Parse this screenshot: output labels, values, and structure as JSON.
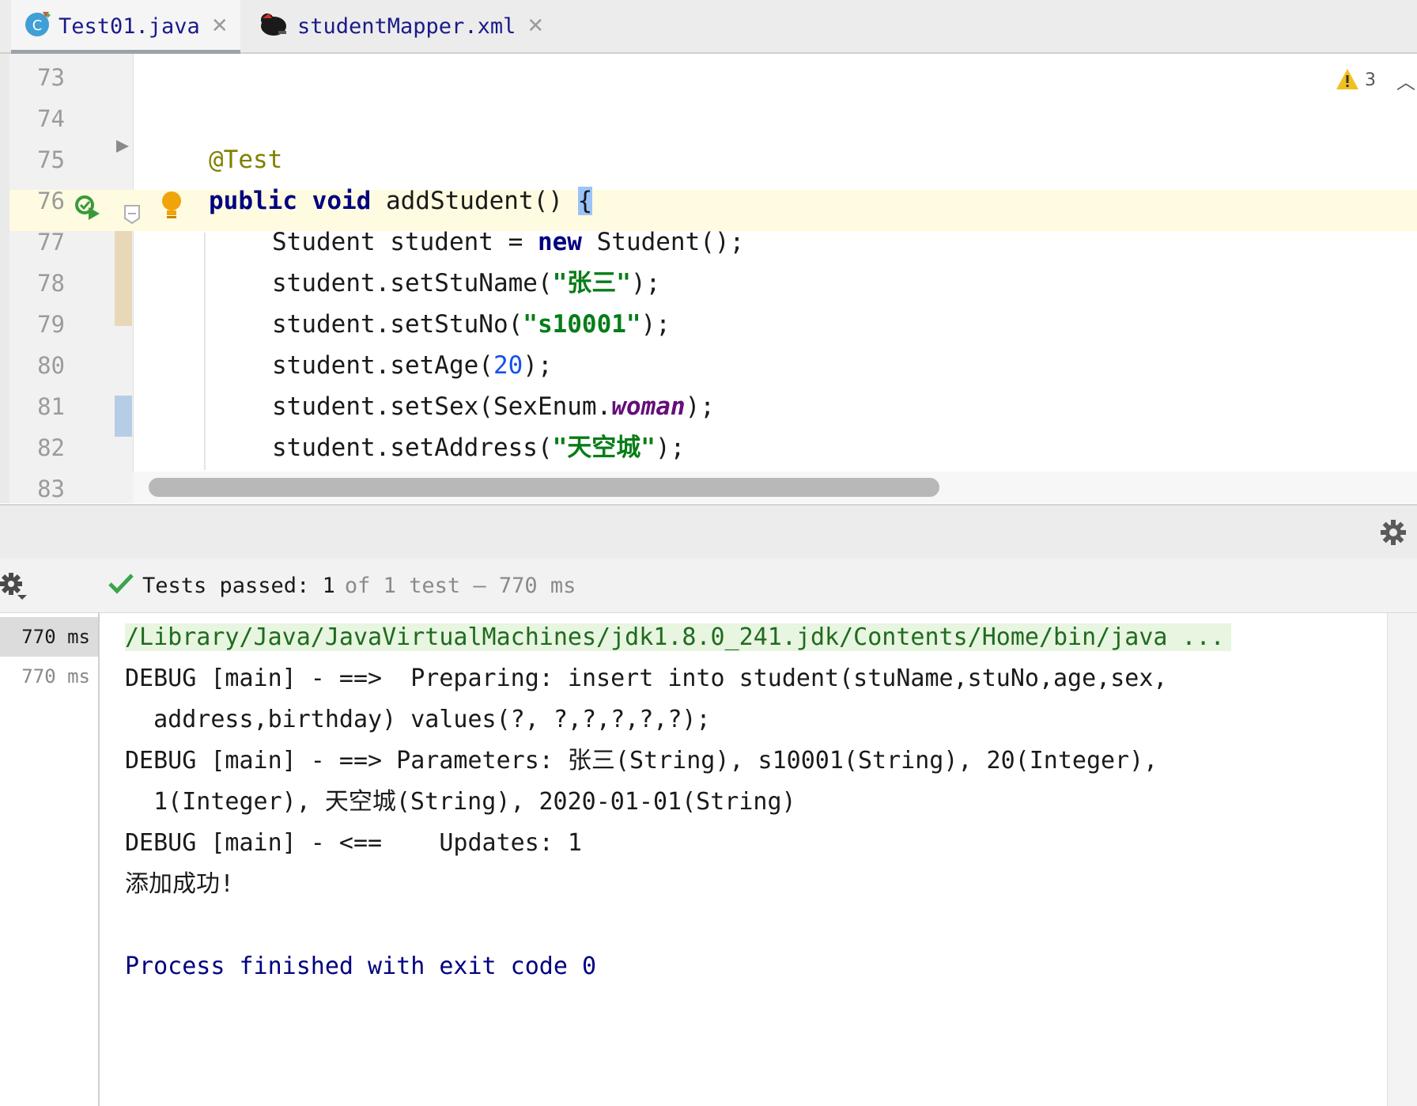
{
  "tabs": [
    {
      "label": "Test01.java",
      "icon": "java-class-icon",
      "active": true
    },
    {
      "label": "studentMapper.xml",
      "icon": "mybatis-bird-icon",
      "active": false
    }
  ],
  "editor": {
    "line_numbers": [
      "73",
      "74",
      "75",
      "76",
      "77",
      "78",
      "79",
      "80",
      "81",
      "82",
      "83"
    ],
    "warning_count": "3",
    "code": {
      "annotation": "@Test",
      "l76_kw1": "public",
      "l76_kw2": "void",
      "l76_rest": " addStudent() ",
      "l76_brace": "{",
      "l77_a": "Student student = ",
      "l77_kw": "new",
      "l77_b": " Student();",
      "l78_a": "student.setStuName(",
      "l78_str": "\"张三\"",
      "l78_b": ");",
      "l79_a": "student.setStuNo(",
      "l79_str": "\"s10001\"",
      "l79_b": ");",
      "l80_a": "student.setAge(",
      "l80_num": "20",
      "l80_b": ");",
      "l81_a": "student.setSex(SexEnum.",
      "l81_fld": "woman",
      "l81_b": ");",
      "l82_a": "student.setAddress(",
      "l82_str": "\"天空城\"",
      "l82_b": ");"
    }
  },
  "run": {
    "status_prefix": "Tests passed: 1",
    "status_suffix": "of 1 test – 770 ms",
    "tests": [
      {
        "duration": "770 ms",
        "selected": true
      },
      {
        "duration": "770 ms",
        "selected": false
      }
    ],
    "console": [
      "/Library/Java/JavaVirtualMachines/jdk1.8.0_241.jdk/Contents/Home/bin/java ...",
      "DEBUG [main] - ==>  Preparing: insert into student(stuName,stuNo,age,sex,",
      "  address,birthday) values(?, ?,?,?,?,?);",
      "DEBUG [main] - ==> Parameters: 张三(String), s10001(String), 20(Integer),",
      "  1(Integer), 天空城(String), 2020-01-01(String)",
      "DEBUG [main] - <==    Updates: 1",
      "添加成功!",
      "",
      "Process finished with exit code 0"
    ]
  }
}
